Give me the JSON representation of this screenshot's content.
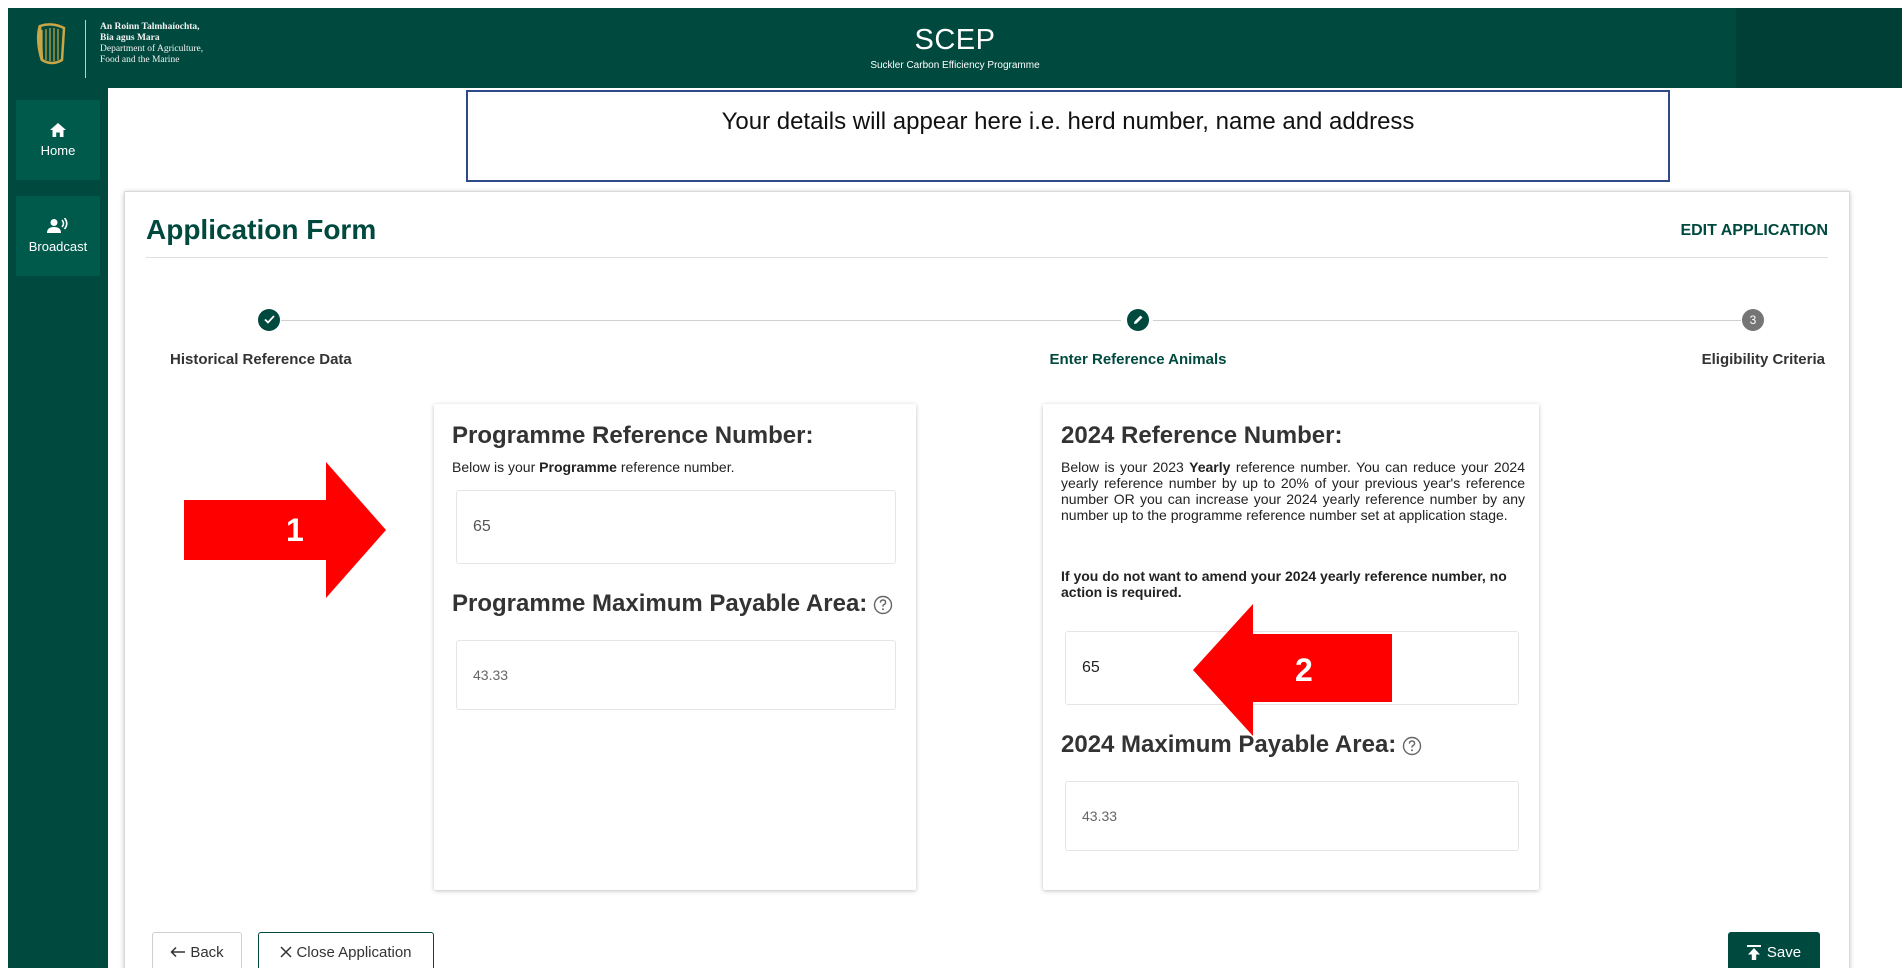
{
  "header": {
    "dept_lines": [
      "An Roinn Talmhaíochta,",
      "Bia agus Mara",
      "Department of Agriculture,",
      "Food and the Marine"
    ],
    "app_title": "SCEP",
    "app_subtitle": "Suckler Carbon Efficiency Programme"
  },
  "sidebar": {
    "items": [
      {
        "label": "Home",
        "icon": "home-icon"
      },
      {
        "label": "Broadcast",
        "icon": "broadcast-icon"
      }
    ]
  },
  "details_banner": "Your details will appear here i.e. herd number, name and address",
  "card": {
    "title": "Application Form",
    "edit_link": "EDIT APPLICATION"
  },
  "stepper": {
    "steps": [
      {
        "label": "Historical Reference Data",
        "state": "complete",
        "icon": "check-icon"
      },
      {
        "label": "Enter Reference Animals",
        "state": "active",
        "icon": "pencil-icon"
      },
      {
        "label": "Eligibility Criteria",
        "state": "pending",
        "number": "3"
      }
    ]
  },
  "programme_panel": {
    "heading": "Programme Reference Number:",
    "desc_prefix": "Below is your ",
    "desc_bold": "Programme",
    "desc_suffix": " reference number.",
    "reference_value": "65",
    "area_heading": "Programme Maximum Payable Area:",
    "area_value": "43.33"
  },
  "yearly_panel": {
    "heading": "2024 Reference Number:",
    "desc_prefix": "Below is your 2023 ",
    "desc_bold": "Yearly",
    "desc_suffix": " reference number. You can reduce your 2024 yearly reference number by up to 20% of your previous year's reference number OR you can increase your 2024 yearly reference number by any number up to the programme reference number set at application stage.",
    "note": "If you do not want to amend your 2024 yearly reference number, no action is required.",
    "reference_value": "65",
    "area_heading": "2024 Maximum Payable Area:",
    "area_value": "43.33"
  },
  "annotations": {
    "arrow1_label": "1",
    "arrow2_label": "2",
    "arrow_color": "#ff0000"
  },
  "buttons": {
    "back": "Back",
    "close": "Close Application",
    "save": "Save"
  },
  "colors": {
    "brand": "#00493e",
    "banner_border": "#2e4a88"
  }
}
